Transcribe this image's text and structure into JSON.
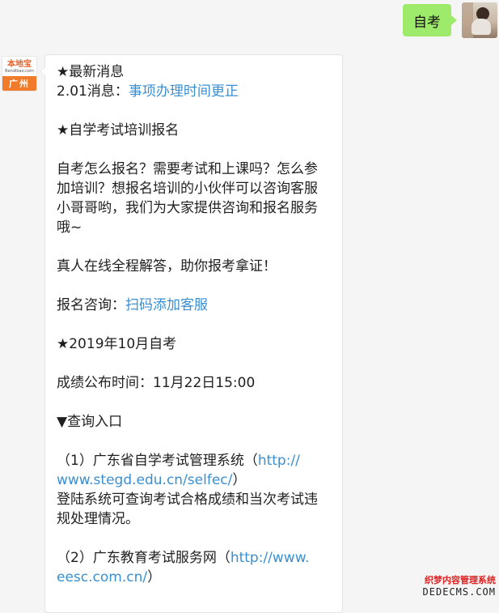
{
  "outgoing": {
    "text": "自考"
  },
  "incoming": {
    "lines": [
      {
        "text": "★最新消息"
      },
      {
        "prefix": "2.01消息：",
        "link": "事项办理时间更正"
      },
      {
        "text": "★自学考试培训报名"
      },
      {
        "text": "自考怎么报名？需要考试和上课吗？怎么参"
      },
      {
        "text": "加培训？想报名培训的小伙伴可以咨询客服"
      },
      {
        "text": "小哥哥哟，我们为大家提供咨询和报名服务"
      },
      {
        "text": "哦~"
      },
      {
        "text": "真人在线全程解答，助你报考拿证！"
      },
      {
        "prefix": "报名咨询：",
        "link": "扫码添加客服"
      },
      {
        "text": "★2019年10月自考"
      },
      {
        "text": "成绩公布时间：11月22日15:00"
      },
      {
        "text": "▼查询入口"
      },
      {
        "prefix": "（1）广东省自学考试管理系统（",
        "link": "http://"
      },
      {
        "link": "www.stegd.edu.cn/selfec/",
        "suffix": "）"
      },
      {
        "text": "登陆系统可查询考试合格成绩和当次考试违"
      },
      {
        "text": "规处理情况。"
      },
      {
        "prefix": "（2）广东教育考试服务网（",
        "link": "http://www."
      },
      {
        "link": "eesc.com.cn/",
        "suffix": "）"
      }
    ]
  },
  "avatar_brand": {
    "logo": "本地宝",
    "logo_sub": "Bendibao.com",
    "city": "广州"
  },
  "watermark": {
    "top": "织梦内容管理系统",
    "bottom": "DEDECMS.COM"
  },
  "colors": {
    "outgoing_bubble": "#9eea6a",
    "link": "#3a8fd1",
    "brand_orange": "#f07c2b"
  }
}
